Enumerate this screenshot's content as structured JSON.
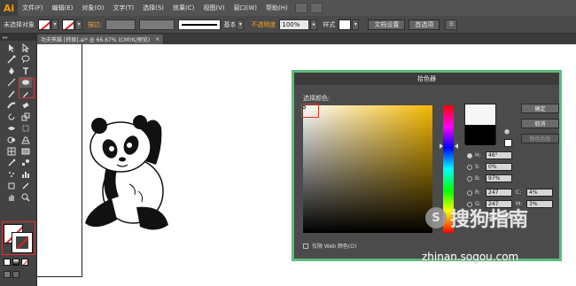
{
  "app": {
    "logo": "Ai"
  },
  "menu": [
    "文件(F)",
    "编辑(E)",
    "对象(O)",
    "文字(T)",
    "选择(S)",
    "效果(C)",
    "视图(V)",
    "窗口(W)",
    "帮助(H)"
  ],
  "control": {
    "selection_label": "未选择对象",
    "stroke_label": "描边:",
    "stroke_style": "基本",
    "opacity_label": "不透明度",
    "opacity_value": "100%",
    "style_label": "样式",
    "doc_setup": "文档设置",
    "preferences": "首选项"
  },
  "document_tab": {
    "title": "功夫熊猫 [转换].ai* @ 66.67% (CMYK/预览)",
    "close": "×"
  },
  "color_picker": {
    "title": "拾色器",
    "select_color_label": "选择颜色:",
    "buttons": {
      "ok": "确定",
      "cancel": "取消",
      "swatches": "颜色色板"
    },
    "fields": {
      "H": {
        "label": "H:",
        "value": "46°"
      },
      "S": {
        "label": "S:",
        "value": "0%"
      },
      "B": {
        "label": "B:",
        "value": "97%"
      },
      "R": {
        "label": "R:",
        "value": "247"
      },
      "G": {
        "label": "G:",
        "value": "247"
      },
      "Bl": {
        "label": "B:",
        "value": "247"
      },
      "C": {
        "label": "C:",
        "value": "4%"
      },
      "M": {
        "label": "M:",
        "value": "3%"
      }
    },
    "web_only_label": "仅限 Web 颜色(O)",
    "new_color": "#f7f7f7",
    "old_color": "#000000"
  },
  "watermark": {
    "logo_char": "S",
    "brand": "搜狗指南",
    "url": "zhinan.sogou.com"
  },
  "colors": {
    "accent_green": "#5dbb7b",
    "highlight_red": "#e03030",
    "logo_orange": "#ff9a00"
  }
}
